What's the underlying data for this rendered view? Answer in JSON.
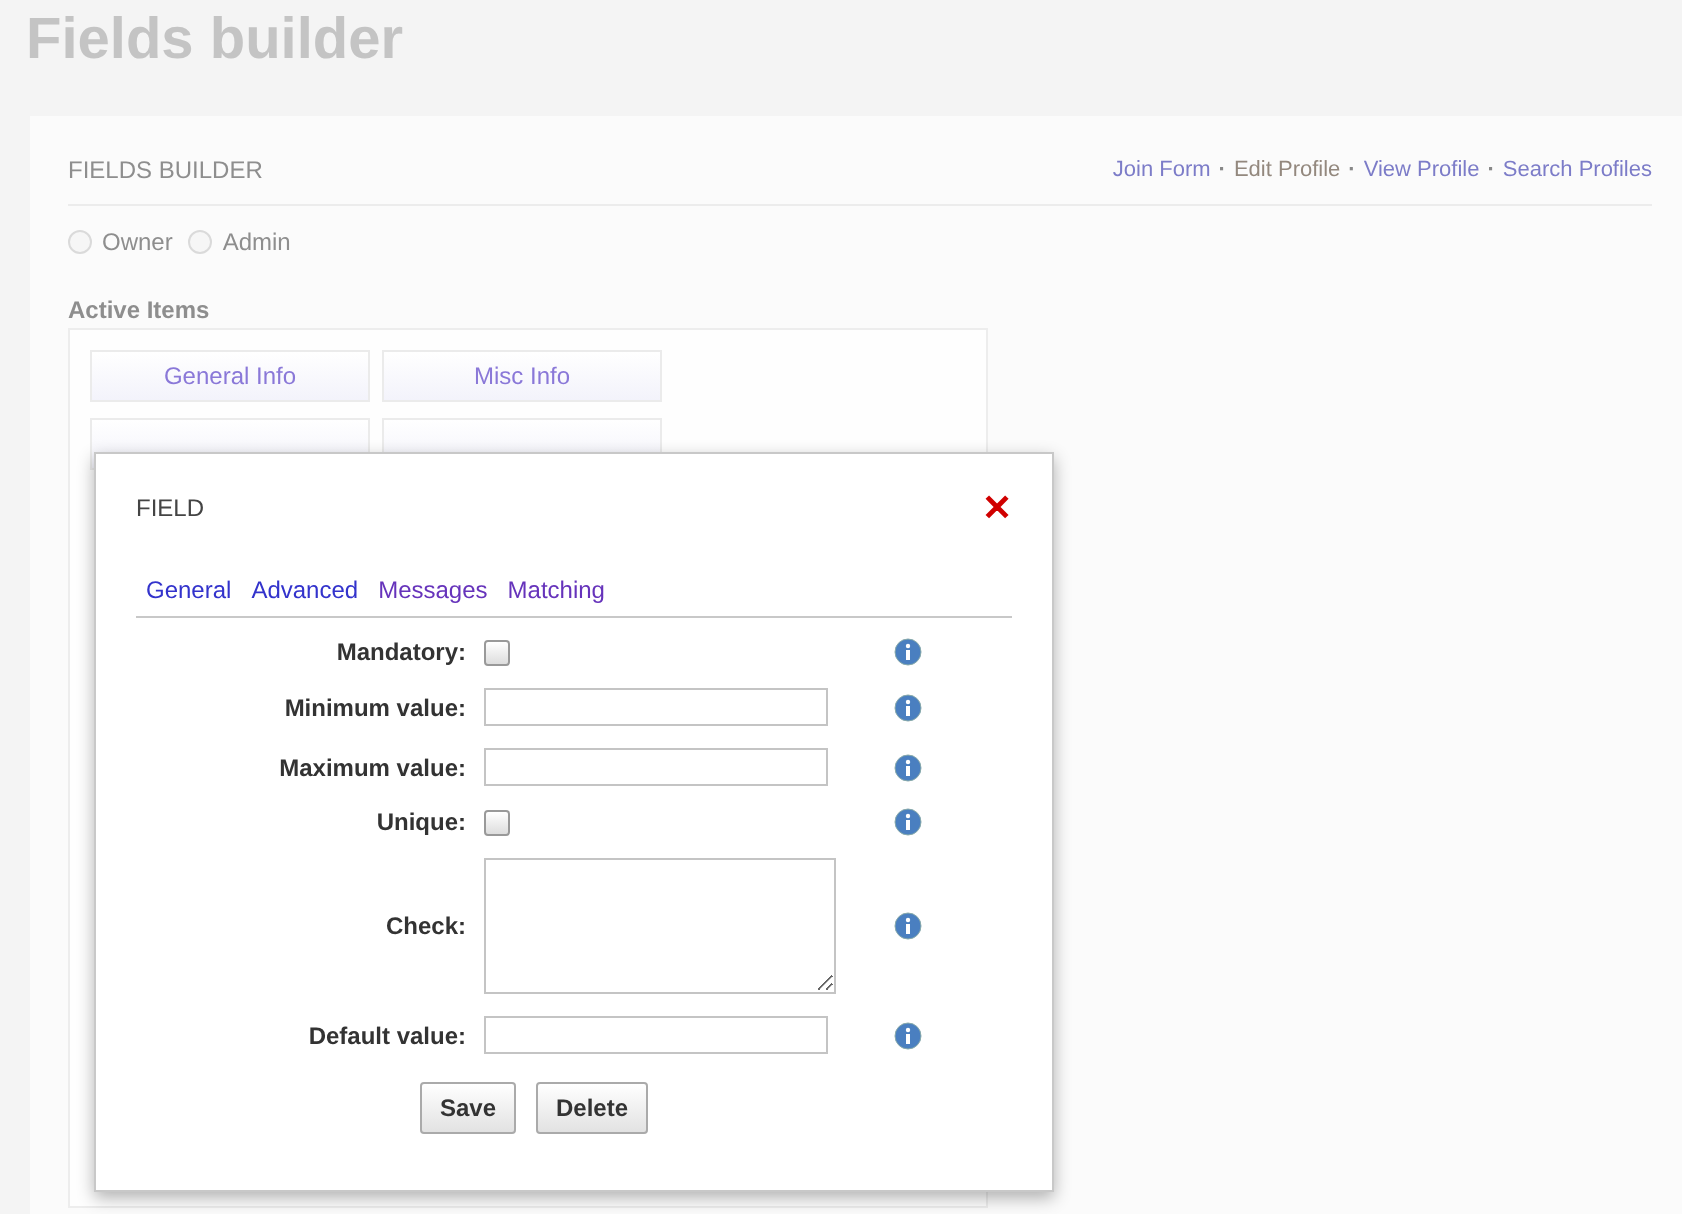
{
  "page_title": "Fields builder",
  "panel": {
    "heading": "FIELDS BUILDER",
    "link_separator": "·",
    "links": [
      {
        "label": "Join Form",
        "visited": false
      },
      {
        "label": "Edit Profile",
        "visited": true
      },
      {
        "label": "View Profile",
        "visited": false
      },
      {
        "label": "Search Profiles",
        "visited": false
      }
    ],
    "roles": [
      {
        "label": "Owner",
        "selected": false
      },
      {
        "label": "Admin",
        "selected": false
      }
    ],
    "active_items_label": "Active Items",
    "active_items": [
      [
        "General Info",
        "Misc Info"
      ]
    ]
  },
  "dialog": {
    "title": "FIELD",
    "close": "✕",
    "tabs": [
      {
        "label": "General",
        "visited": false
      },
      {
        "label": "Advanced",
        "visited": false
      },
      {
        "label": "Messages",
        "visited": true
      },
      {
        "label": "Matching",
        "visited": true
      }
    ],
    "fields": [
      {
        "label": "Mandatory:",
        "kind": "checkbox",
        "checked": false
      },
      {
        "label": "Minimum value:",
        "kind": "text"
      },
      {
        "label": "Maximum value:",
        "kind": "text"
      },
      {
        "label": "Unique:",
        "kind": "checkbox",
        "checked": false
      },
      {
        "label": "Check:",
        "kind": "textarea"
      },
      {
        "label": "Default value:",
        "kind": "text"
      }
    ],
    "buttons": [
      "Save",
      "Delete"
    ]
  }
}
